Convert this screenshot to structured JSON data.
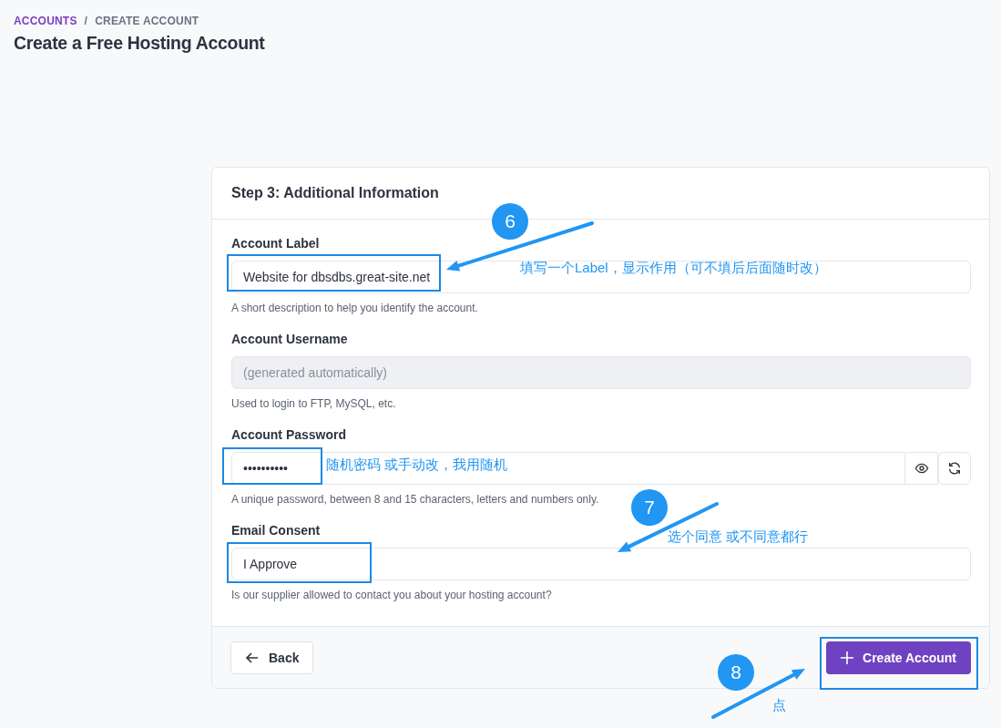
{
  "breadcrumb": [
    {
      "label": "ACCOUNTS",
      "link": true
    },
    {
      "label": "CREATE ACCOUNT",
      "link": false
    }
  ],
  "breadcrumb_separator": "/",
  "title": "Create a Free Hosting Account",
  "card": {
    "title": "Step 3: Additional Information",
    "fields": [
      {
        "label": "Account Label",
        "kind": "text",
        "value": "Website for dbsdbs.great-site.net",
        "disabled": false,
        "hint": "A short description to help you identify the account."
      },
      {
        "label": "Account Username",
        "kind": "text",
        "placeholder": "(generated automatically)",
        "disabled": true,
        "hint": "Used to login to FTP, MySQL, etc."
      },
      {
        "label": "Account Password",
        "kind": "password",
        "value": "••••••••••",
        "disabled": false,
        "hint": "A unique password, between 8 and 15 characters, letters and numbers only."
      },
      {
        "label": "Email Consent",
        "kind": "select",
        "value": "I Approve",
        "disabled": false,
        "hint": "Is our supplier allowed to contact you about your hosting account?"
      }
    ],
    "back_button": "Back",
    "submit_button": "Create Account"
  },
  "annotations": [
    {
      "number": "6",
      "note": "填写一个Label，显示作用（可不填后后面随时改）"
    },
    {
      "number": "7",
      "note": "选个同意 或不同意都行"
    },
    {
      "number": "8",
      "note": "点"
    }
  ],
  "password_note": "随机密码 或手动改，我用随机"
}
